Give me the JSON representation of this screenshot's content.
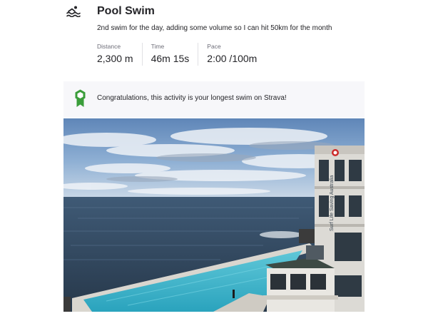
{
  "activity": {
    "title": "Pool Swim",
    "description": "2nd swim for the day, adding some volume so I can hit 50km for the month",
    "icon": "swim-icon"
  },
  "stats": [
    {
      "label": "Distance",
      "value": "2,300 m"
    },
    {
      "label": "Time",
      "value": "46m 15s"
    },
    {
      "label": "Pace",
      "value": "2:00 /100m"
    }
  ],
  "achievement": {
    "icon": "medal-icon",
    "text": "Congratulations, this activity is your longest swim on Strava!",
    "color": "#3a9d3a"
  },
  "photo": {
    "sign_text": "Surf Life Saving Australia"
  }
}
